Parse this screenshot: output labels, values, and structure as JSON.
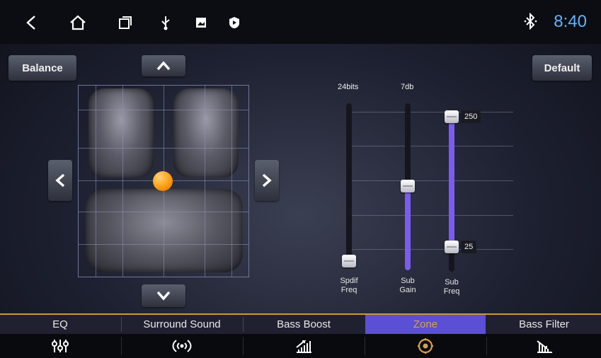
{
  "status": {
    "time": "8:40"
  },
  "buttons": {
    "balance": "Balance",
    "default": "Default"
  },
  "sliders": [
    {
      "name": "Spdif Freq",
      "label_lines": [
        "Spdif",
        "Freq"
      ],
      "top_value": "24bits",
      "level": 0.0
    },
    {
      "name": "Sub Gain",
      "label_lines": [
        "Sub",
        "Gain"
      ],
      "top_value": "7db",
      "level": 0.55
    },
    {
      "name": "Sub Freq",
      "label_lines": [
        "Sub",
        "Freq"
      ],
      "max_value": "250",
      "min_value": "25",
      "level": 0.15
    }
  ],
  "tabs": [
    {
      "label": "EQ",
      "icon": "equalizer-icon"
    },
    {
      "label": "Surround Sound",
      "icon": "surround-icon"
    },
    {
      "label": "Bass Boost",
      "icon": "bass-boost-icon"
    },
    {
      "label": "Zone",
      "icon": "zone-icon",
      "active": true
    },
    {
      "label": "Bass Filter",
      "icon": "bass-filter-icon"
    }
  ],
  "colors": {
    "accent": "#5b4fd6",
    "active_text": "#d9a04a",
    "clock": "#5fb3ff",
    "position_dot": "#ff9d10"
  }
}
